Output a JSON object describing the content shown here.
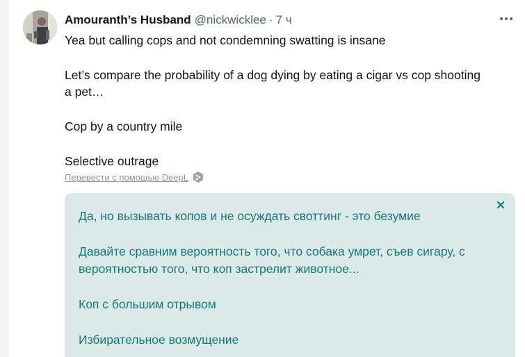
{
  "tweet": {
    "author": {
      "name": "Amouranth’s Husband",
      "handle": "@nickwicklee",
      "separator": "·",
      "time": "7 ч",
      "avatar_icon": "user-avatar"
    },
    "more_icon": "more-horizontal-icon",
    "text": {
      "p1": "Yea but calling cops and not condemning swatting is insane",
      "p2": "Let’s compare  the probability of a dog dying by eating a cigar vs cop shooting a pet…",
      "p3": "Cop by a country mile",
      "p4": "Selective outrage"
    },
    "translate": {
      "link_text": "Перевести с помощью DeepL",
      "icon": "deepl-icon"
    }
  },
  "translation": {
    "close_icon": "close-icon",
    "lines": {
      "l1": "Да, но вызывать копов и не осуждать своттинг - это безумие",
      "l2": " Давайте сравним вероятность того, что собака умрет, съев сигару, с вероятностью того, что коп застрелит животное...",
      "l3": " Коп с большим отрывом",
      "l4": " Избирательное возмущение"
    }
  },
  "colors": {
    "text_primary": "#0f1419",
    "text_secondary": "#536471",
    "translation_bg": "#dce9e9",
    "translation_text": "#137a73"
  }
}
